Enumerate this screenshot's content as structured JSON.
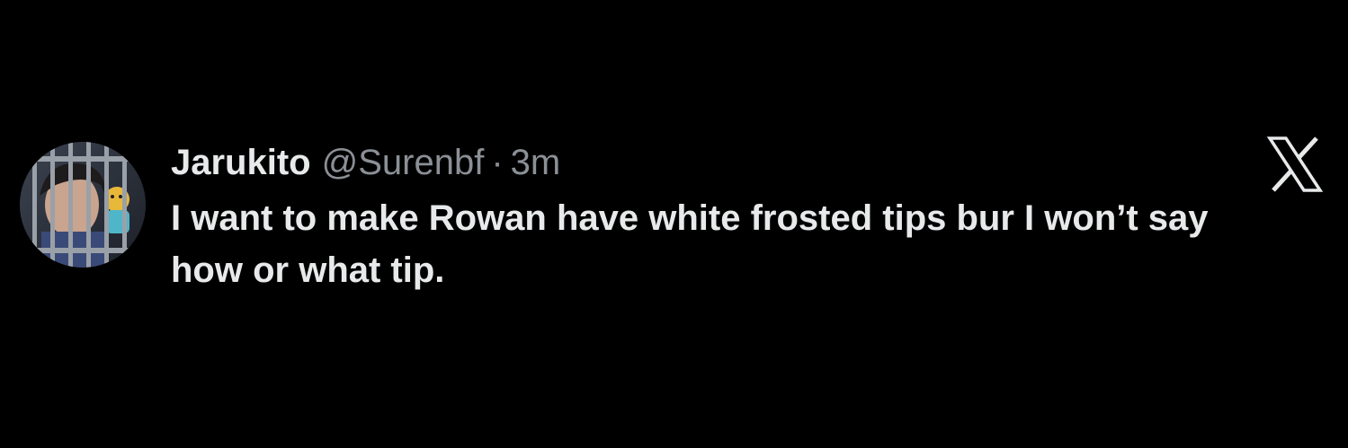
{
  "colors": {
    "background": "#000000",
    "primary_text": "#e7e9ea",
    "secondary_text": "#8b9096"
  },
  "tweet": {
    "display_name": "Jarukito",
    "handle": "@Surenbf",
    "separator": "·",
    "timestamp": "3m",
    "text": "I want to make Rowan have white frosted tips bur I won’t say how or what tip."
  },
  "icons": {
    "brand": "x-logo-icon",
    "avatar": "avatar-photo"
  }
}
